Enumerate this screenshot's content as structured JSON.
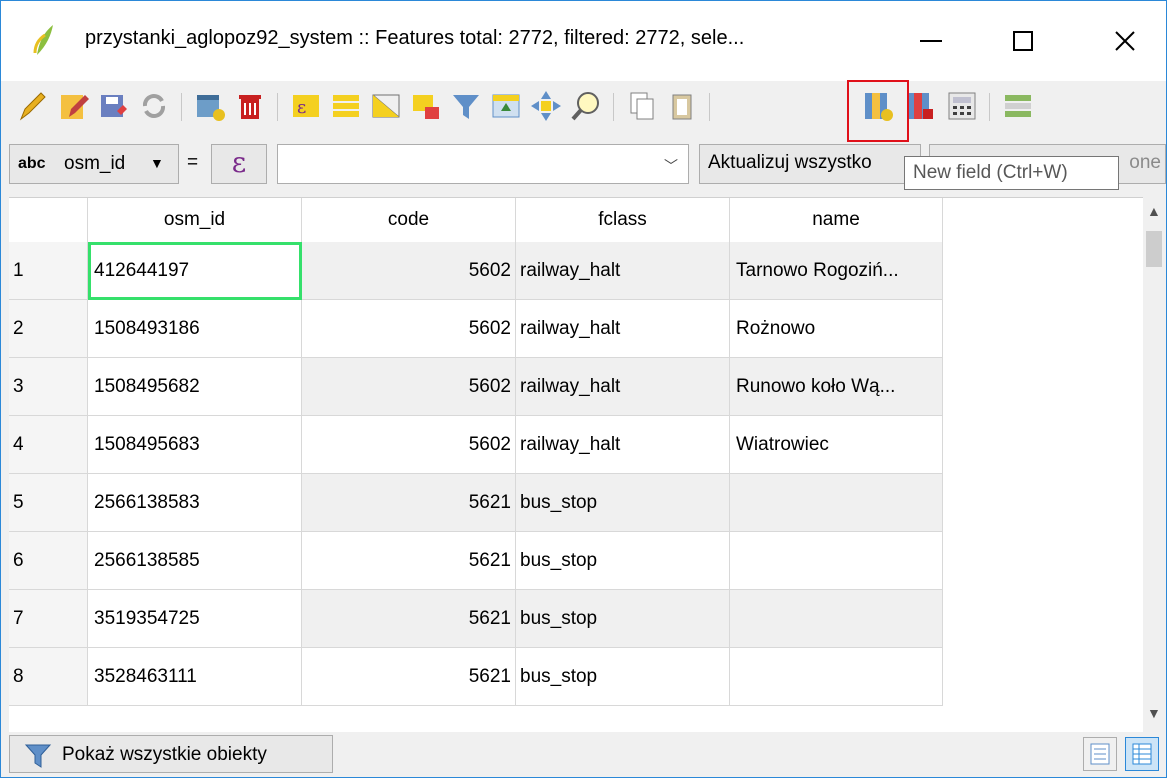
{
  "window": {
    "title": "przystanki_aglopoz92_system :: Features total: 2772, filtered: 2772, sele...",
    "minimize_glyph": "—",
    "maximize_glyph": "☐",
    "close_glyph": "✕"
  },
  "toolbar": {
    "icons": [
      "pencil-icon",
      "multi-edit-icon",
      "save-edits-icon",
      "reload-icon",
      "add-feature-icon",
      "delete-feature-icon",
      "select-by-expression-icon",
      "select-all-icon",
      "invert-selection-icon",
      "deselect-all-icon",
      "filter-selection-icon",
      "move-selection-top-icon",
      "pan-to-selection-icon",
      "zoom-to-selection-icon",
      "copy-icon",
      "paste-icon",
      "new-field-icon",
      "delete-field-icon",
      "field-calculator-icon",
      "conditional-formatting-icon"
    ]
  },
  "filter": {
    "field_type": "abc",
    "field": "osm_id",
    "operator": "=",
    "expression_symbol": "ε",
    "value": "",
    "update_all_label": "Aktualizuj wszystko",
    "update_selected_label": "one"
  },
  "tooltip": {
    "text": "New field (Ctrl+W)"
  },
  "table": {
    "columns": [
      "osm_id",
      "code",
      "fclass",
      "name"
    ],
    "rows": [
      {
        "num": "1",
        "osm_id": "412644197",
        "code": "5602",
        "fclass": "railway_halt",
        "name": "Tarnowo Rogoziń..."
      },
      {
        "num": "2",
        "osm_id": "1508493186",
        "code": "5602",
        "fclass": "railway_halt",
        "name": "Rożnowo"
      },
      {
        "num": "3",
        "osm_id": "1508495682",
        "code": "5602",
        "fclass": "railway_halt",
        "name": "Runowo koło Wą..."
      },
      {
        "num": "4",
        "osm_id": "1508495683",
        "code": "5602",
        "fclass": "railway_halt",
        "name": "Wiatrowiec"
      },
      {
        "num": "5",
        "osm_id": "2566138583",
        "code": "5621",
        "fclass": "bus_stop",
        "name": ""
      },
      {
        "num": "6",
        "osm_id": "2566138585",
        "code": "5621",
        "fclass": "bus_stop",
        "name": ""
      },
      {
        "num": "7",
        "osm_id": "3519354725",
        "code": "5621",
        "fclass": "bus_stop",
        "name": ""
      },
      {
        "num": "8",
        "osm_id": "3528463111",
        "code": "5621",
        "fclass": "bus_stop",
        "name": ""
      }
    ]
  },
  "bottom": {
    "show_all_label": "Pokaż wszystkie obiekty"
  },
  "colors": {
    "highlight": "#e0101a",
    "selected_cell": "#35e06b",
    "accent": "#2b88d8"
  }
}
